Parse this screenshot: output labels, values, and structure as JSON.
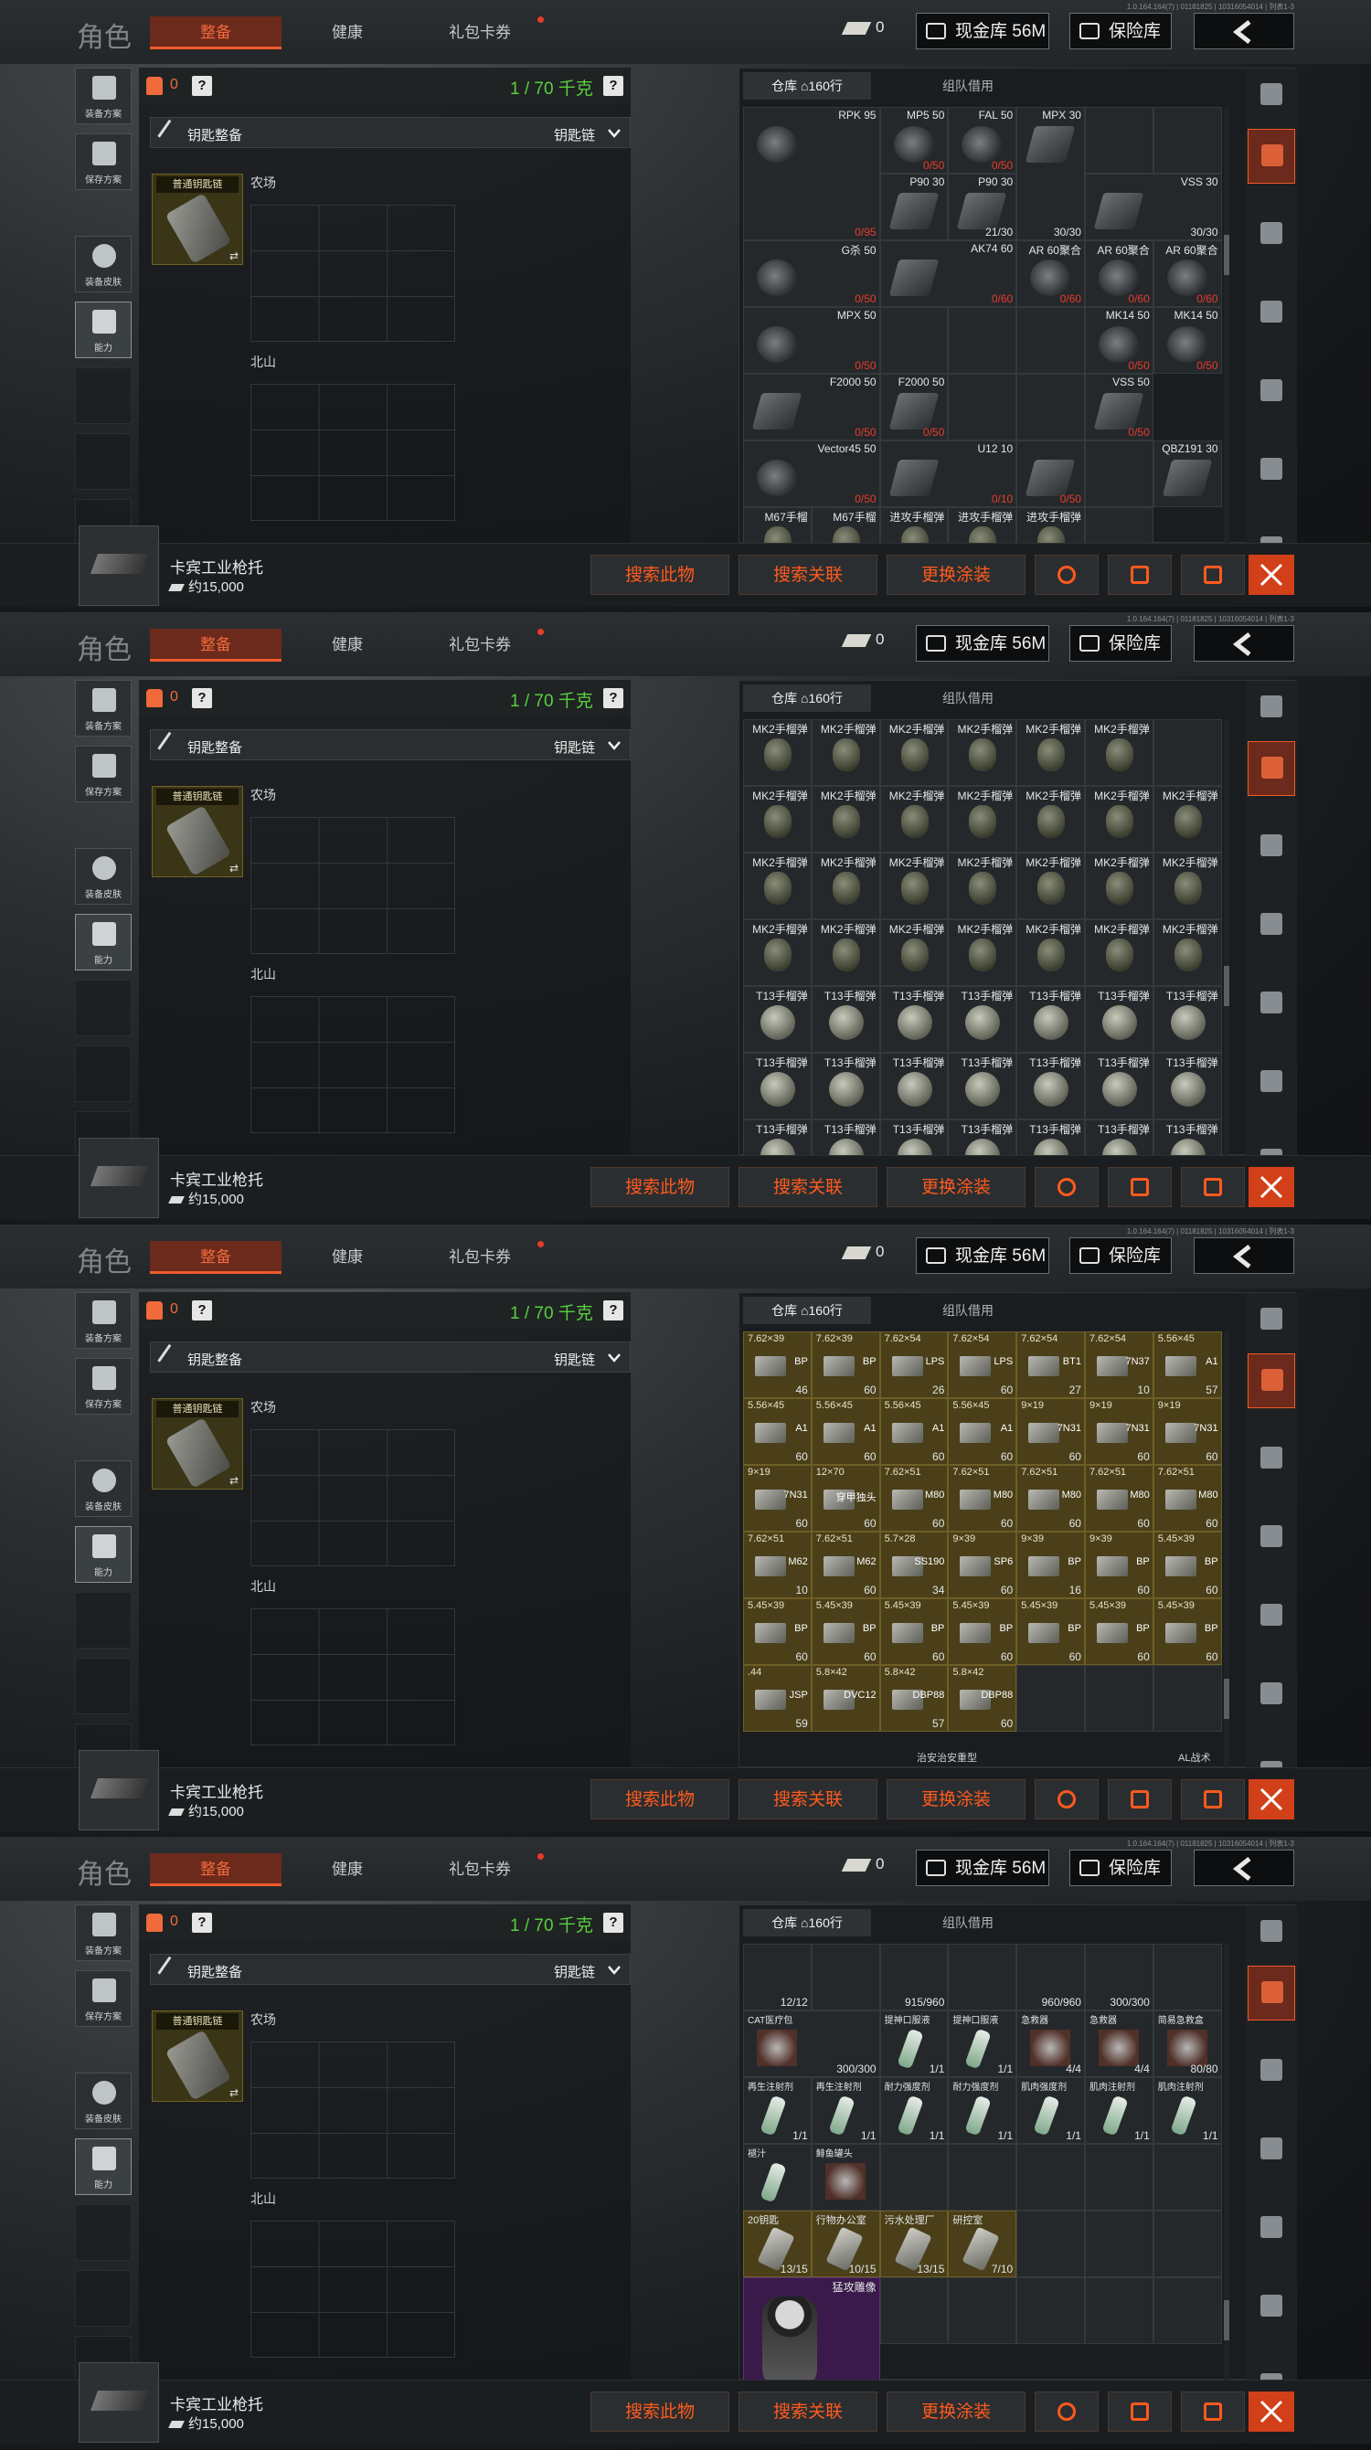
{
  "common": {
    "version": "1.0.164.164(7) | 01181825 | 10316054014 | 列表1-3",
    "role": "角色",
    "tabs": [
      "整备",
      "健康",
      "礼包卡券"
    ],
    "cash": "0",
    "cash_btn": "现金库 56M",
    "safe_btn": "保险库",
    "side": [
      "装备方案",
      "保存方案",
      "装备皮肤",
      "能力"
    ],
    "bag_count": "0",
    "weight": "1 / 70 千克",
    "q": "?",
    "keybar_left": "钥匙整备",
    "keybar_right": "钥匙链",
    "key_label": "普通钥匙链",
    "areas": [
      "农场",
      "北山"
    ],
    "storage_tab1": "仓库",
    "storage_rows": "160行",
    "storage_tab2": "组队借用",
    "item_name": "卡宾工业枪托",
    "item_price": "约15,000",
    "actions": [
      "搜索此物",
      "搜索关联",
      "更换涂装"
    ]
  },
  "panel1": [
    {
      "n": "RPK 95",
      "c": "0/95",
      "t": "drum",
      "w": 2,
      "h": 2
    },
    {
      "n": "MP5 50",
      "c": "0/50",
      "t": "drum"
    },
    {
      "n": "FAL 50",
      "c": "0/50",
      "t": "drum"
    },
    {
      "n": "MPX 30",
      "c": "30/30",
      "t": "mag",
      "h": 2
    },
    {
      "n": "",
      "c": "",
      "t": "none"
    },
    {
      "n": "",
      "c": "",
      "t": "none"
    },
    {
      "n": "P90 30",
      "c": "",
      "t": "mag"
    },
    {
      "n": "P90 30",
      "c": "21/30",
      "t": "mag"
    },
    {
      "n": "VSS 30",
      "c": "30/30",
      "t": "mag",
      "w": 2
    },
    {
      "n": "G杀 50",
      "c": "0/50",
      "t": "drum",
      "w": 2
    },
    {
      "n": "AK74 60",
      "c": "0/60",
      "t": "mag",
      "w": 2
    },
    {
      "n": "AR 60聚合",
      "c": "0/60",
      "t": "drum"
    },
    {
      "n": "AR 60聚合",
      "c": "0/60",
      "t": "drum"
    },
    {
      "n": "AR 60聚合",
      "c": "0/60",
      "t": "drum"
    },
    {
      "n": "MPX 50",
      "c": "0/50",
      "t": "drum",
      "w": 2
    },
    {
      "n": "",
      "c": "",
      "t": "none"
    },
    {
      "n": "",
      "c": "",
      "t": "none"
    },
    {
      "n": "",
      "c": "",
      "t": "none"
    },
    {
      "n": "MK14 50",
      "c": "0/50",
      "t": "drum"
    },
    {
      "n": "MK14 50",
      "c": "0/50",
      "t": "drum"
    },
    {
      "n": "F2000 50",
      "c": "0/50",
      "t": "mag",
      "w": 2
    },
    {
      "n": "F2000 50",
      "c": "0/50",
      "t": "mag"
    },
    {
      "n": "",
      "c": "",
      "t": "none"
    },
    {
      "n": "",
      "c": "",
      "t": "none"
    },
    {
      "n": "VSS 50",
      "c": "0/50",
      "t": "mag"
    },
    {
      "n": "Vector45 50",
      "c": "0/50",
      "t": "drum",
      "w": 2
    },
    {
      "n": "U12 10",
      "c": "0/10",
      "t": "mag",
      "w": 2
    },
    {
      "n": "",
      "c": "0/50",
      "t": "mag"
    },
    {
      "n": "",
      "c": "",
      "t": "none"
    },
    {
      "n": "QBZ191 30",
      "c": "",
      "t": "mag"
    },
    {
      "n": "M67手榴",
      "c": "",
      "t": "gren"
    },
    {
      "n": "M67手榴",
      "c": "",
      "t": "gren"
    },
    {
      "n": "进攻手榴弹",
      "c": "",
      "t": "gren"
    },
    {
      "n": "进攻手榴弹",
      "c": "",
      "t": "gren"
    },
    {
      "n": "进攻手榴弹",
      "c": "",
      "t": "gren"
    },
    {
      "n": "",
      "c": "",
      "t": "none"
    }
  ],
  "panel2": [
    {
      "n": "MK2手榴弹",
      "t": "gren"
    },
    {
      "n": "MK2手榴弹",
      "t": "gren"
    },
    {
      "n": "MK2手榴弹",
      "t": "gren"
    },
    {
      "n": "MK2手榴弹",
      "t": "gren"
    },
    {
      "n": "MK2手榴弹",
      "t": "gren"
    },
    {
      "n": "MK2手榴弹",
      "t": "gren"
    },
    {
      "n": "",
      "t": "none"
    },
    {
      "n": "MK2手榴弹",
      "t": "gren"
    },
    {
      "n": "MK2手榴弹",
      "t": "gren"
    },
    {
      "n": "MK2手榴弹",
      "t": "gren"
    },
    {
      "n": "MK2手榴弹",
      "t": "gren"
    },
    {
      "n": "MK2手榴弹",
      "t": "gren"
    },
    {
      "n": "MK2手榴弹",
      "t": "gren"
    },
    {
      "n": "MK2手榴弹",
      "t": "gren"
    },
    {
      "n": "MK2手榴弹",
      "t": "gren"
    },
    {
      "n": "MK2手榴弹",
      "t": "gren"
    },
    {
      "n": "MK2手榴弹",
      "t": "gren"
    },
    {
      "n": "MK2手榴弹",
      "t": "gren"
    },
    {
      "n": "MK2手榴弹",
      "t": "gren"
    },
    {
      "n": "MK2手榴弹",
      "t": "gren"
    },
    {
      "n": "MK2手榴弹",
      "t": "gren"
    },
    {
      "n": "MK2手榴弹",
      "t": "gren"
    },
    {
      "n": "MK2手榴弹",
      "t": "gren"
    },
    {
      "n": "MK2手榴弹",
      "t": "gren"
    },
    {
      "n": "MK2手榴弹",
      "t": "gren"
    },
    {
      "n": "MK2手榴弹",
      "t": "gren"
    },
    {
      "n": "MK2手榴弹",
      "t": "gren"
    },
    {
      "n": "MK2手榴弹",
      "t": "gren"
    },
    {
      "n": "T13手榴弹",
      "t": "t13"
    },
    {
      "n": "T13手榴弹",
      "t": "t13"
    },
    {
      "n": "T13手榴弹",
      "t": "t13"
    },
    {
      "n": "T13手榴弹",
      "t": "t13"
    },
    {
      "n": "T13手榴弹",
      "t": "t13"
    },
    {
      "n": "T13手榴弹",
      "t": "t13"
    },
    {
      "n": "T13手榴弹",
      "t": "t13"
    },
    {
      "n": "T13手榴弹",
      "t": "t13"
    },
    {
      "n": "T13手榴弹",
      "t": "t13"
    },
    {
      "n": "T13手榴弹",
      "t": "t13"
    },
    {
      "n": "T13手榴弹",
      "t": "t13"
    },
    {
      "n": "T13手榴弹",
      "t": "t13"
    },
    {
      "n": "T13手榴弹",
      "t": "t13"
    },
    {
      "n": "T13手榴弹",
      "t": "t13"
    },
    {
      "n": "T13手榴弹",
      "t": "t13"
    },
    {
      "n": "T13手榴弹",
      "t": "t13"
    },
    {
      "n": "T13手榴弹",
      "t": "t13"
    },
    {
      "n": "T13手榴弹",
      "t": "t13"
    },
    {
      "n": "T13手榴弹",
      "t": "t13"
    },
    {
      "n": "T13手榴弹",
      "t": "t13"
    },
    {
      "n": "T13手榴弹",
      "t": "t13"
    }
  ],
  "panel3": [
    {
      "n": "7.62×39",
      "tag": "BP",
      "c": "46"
    },
    {
      "n": "7.62×39",
      "tag": "BP",
      "c": "60"
    },
    {
      "n": "7.62×54",
      "tag": "LPS",
      "c": "26"
    },
    {
      "n": "7.62×54",
      "tag": "LPS",
      "c": "60"
    },
    {
      "n": "7.62×54",
      "tag": "BT1",
      "c": "27"
    },
    {
      "n": "7.62×54",
      "tag": "7N37",
      "c": "10"
    },
    {
      "n": "5.56×45",
      "tag": "A1",
      "c": "57"
    },
    {
      "n": "5.56×45",
      "tag": "A1",
      "c": "60"
    },
    {
      "n": "5.56×45",
      "tag": "A1",
      "c": "60"
    },
    {
      "n": "5.56×45",
      "tag": "A1",
      "c": "60"
    },
    {
      "n": "5.56×45",
      "tag": "A1",
      "c": "60"
    },
    {
      "n": "9×19",
      "tag": "7N31",
      "c": "60"
    },
    {
      "n": "9×19",
      "tag": "7N31",
      "c": "60"
    },
    {
      "n": "9×19",
      "tag": "7N31",
      "c": "60"
    },
    {
      "n": "9×19",
      "tag": "7N31",
      "c": "60"
    },
    {
      "n": "12×70",
      "tag": "穿甲独头",
      "c": "60"
    },
    {
      "n": "7.62×51",
      "tag": "M80",
      "c": "60"
    },
    {
      "n": "7.62×51",
      "tag": "M80",
      "c": "60"
    },
    {
      "n": "7.62×51",
      "tag": "M80",
      "c": "60"
    },
    {
      "n": "7.62×51",
      "tag": "M80",
      "c": "60"
    },
    {
      "n": "7.62×51",
      "tag": "M80",
      "c": "60"
    },
    {
      "n": "7.62×51",
      "tag": "M62",
      "c": "10"
    },
    {
      "n": "7.62×51",
      "tag": "M62",
      "c": "60"
    },
    {
      "n": "5.7×28",
      "tag": "SS190",
      "c": "34"
    },
    {
      "n": "9×39",
      "tag": "SP6",
      "c": "60"
    },
    {
      "n": "9×39",
      "tag": "BP",
      "c": "16"
    },
    {
      "n": "9×39",
      "tag": "BP",
      "c": "60"
    },
    {
      "n": "5.45×39",
      "tag": "BP",
      "c": "60"
    },
    {
      "n": "5.45×39",
      "tag": "BP",
      "c": "60"
    },
    {
      "n": "5.45×39",
      "tag": "BP",
      "c": "60"
    },
    {
      "n": "5.45×39",
      "tag": "BP",
      "c": "60"
    },
    {
      "n": "5.45×39",
      "tag": "BP",
      "c": "60"
    },
    {
      "n": "5.45×39",
      "tag": "BP",
      "c": "60"
    },
    {
      "n": "5.45×39",
      "tag": "BP",
      "c": "60"
    },
    {
      "n": "5.45×39",
      "tag": "BP",
      "c": "60"
    },
    {
      "n": ".44",
      "tag": "JSP",
      "c": "59"
    },
    {
      "n": "5.8×42",
      "tag": "DVC12",
      "c": ""
    },
    {
      "n": "5.8×42",
      "tag": "DBP88",
      "c": "57"
    },
    {
      "n": "5.8×42",
      "tag": "DBP88",
      "c": "60"
    },
    {
      "n": "",
      "tag": "",
      "c": "",
      "t": "none"
    },
    {
      "n": "",
      "tag": "",
      "c": "",
      "t": "none"
    },
    {
      "n": "",
      "tag": "",
      "c": "",
      "t": "none"
    }
  ],
  "panel3_footer": [
    "治安治安重型",
    "AL战术"
  ],
  "panel4": [
    {
      "n": "",
      "c": "12/12",
      "t": "none"
    },
    {
      "n": "",
      "c": "",
      "t": "none"
    },
    {
      "n": "",
      "c": "915/960",
      "t": "none"
    },
    {
      "n": "",
      "c": "",
      "t": "none"
    },
    {
      "n": "",
      "c": "960/960",
      "t": "none"
    },
    {
      "n": "",
      "c": "300/300",
      "t": "none"
    },
    {
      "n": "",
      "c": "",
      "t": "none"
    },
    {
      "n": "CAT医疗包",
      "c": "300/300",
      "t": "red",
      "w": 2
    },
    {
      "n": "提神口服液",
      "c": "1/1",
      "t": "med"
    },
    {
      "n": "提神口服液",
      "c": "1/1",
      "t": "med"
    },
    {
      "n": "急救器",
      "c": "4/4",
      "t": "red"
    },
    {
      "n": "急救器",
      "c": "4/4",
      "t": "red"
    },
    {
      "n": "简易急救盒",
      "c": "80/80",
      "t": "red"
    },
    {
      "n": "再生注射剂",
      "c": "1/1",
      "t": "med"
    },
    {
      "n": "再生注射剂",
      "c": "1/1",
      "t": "med"
    },
    {
      "n": "耐力强度剂",
      "c": "1/1",
      "t": "med"
    },
    {
      "n": "耐力强度剂",
      "c": "1/1",
      "t": "med"
    },
    {
      "n": "肌肉强度剂",
      "c": "1/1",
      "t": "med"
    },
    {
      "n": "肌肉注射剂",
      "c": "1/1",
      "t": "med"
    },
    {
      "n": "肌肉注射剂",
      "c": "1/1",
      "t": "med"
    },
    {
      "n": "褪汁",
      "c": "",
      "t": "med"
    },
    {
      "n": "鲱鱼罐头",
      "c": "",
      "t": "red"
    },
    {
      "n": "",
      "c": "",
      "t": "none"
    },
    {
      "n": "",
      "c": "",
      "t": "none"
    },
    {
      "n": "",
      "c": "",
      "t": "none"
    },
    {
      "n": "",
      "c": "",
      "t": "none"
    },
    {
      "n": "",
      "c": "",
      "t": "none"
    },
    {
      "n": "20钥匙",
      "c": "13/15",
      "t": "keyc"
    },
    {
      "n": "行物办公室",
      "c": "10/15",
      "t": "keyc"
    },
    {
      "n": "污水处理厂",
      "c": "13/15",
      "t": "keyc"
    },
    {
      "n": "研控室",
      "c": "7/10",
      "t": "keyc"
    },
    {
      "n": "",
      "c": "",
      "t": "none"
    },
    {
      "n": "",
      "c": "",
      "t": "none"
    },
    {
      "n": "",
      "c": "",
      "t": "none"
    },
    {
      "n": "猛攻雕像",
      "c": "",
      "t": "purple",
      "w": 2,
      "h": 2
    },
    {
      "n": "",
      "c": "",
      "t": "none"
    },
    {
      "n": "",
      "c": "",
      "t": "none"
    },
    {
      "n": "",
      "c": "",
      "t": "none"
    },
    {
      "n": "",
      "c": "",
      "t": "none"
    },
    {
      "n": "",
      "c": "",
      "t": "none"
    }
  ]
}
